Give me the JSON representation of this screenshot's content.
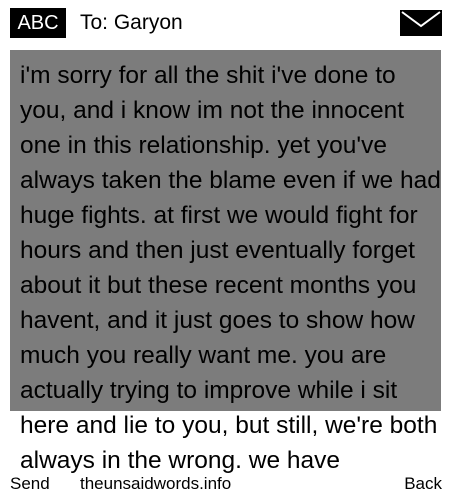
{
  "header": {
    "input_mode": "ABC",
    "recipient": "To: Garyon",
    "icon": "envelope-icon"
  },
  "message": {
    "body": "i'm sorry for all the shit i've done to you, and i know im not the innocent one in this relationship. yet you've always taken the blame even if we had huge fights. at first we would fight for hours and then just eventually forget about it but these recent months you havent, and it just goes to show how much you really want me. you are actually trying to improve while i sit here and lie to you, but still, we're both always in the wrong. we have"
  },
  "softkeys": {
    "left_label": "Send",
    "watermark": "theunsaidwords.info",
    "right_label": "Back"
  },
  "colors": {
    "message_background": "#7c7c7c",
    "badge_background": "#000000"
  }
}
